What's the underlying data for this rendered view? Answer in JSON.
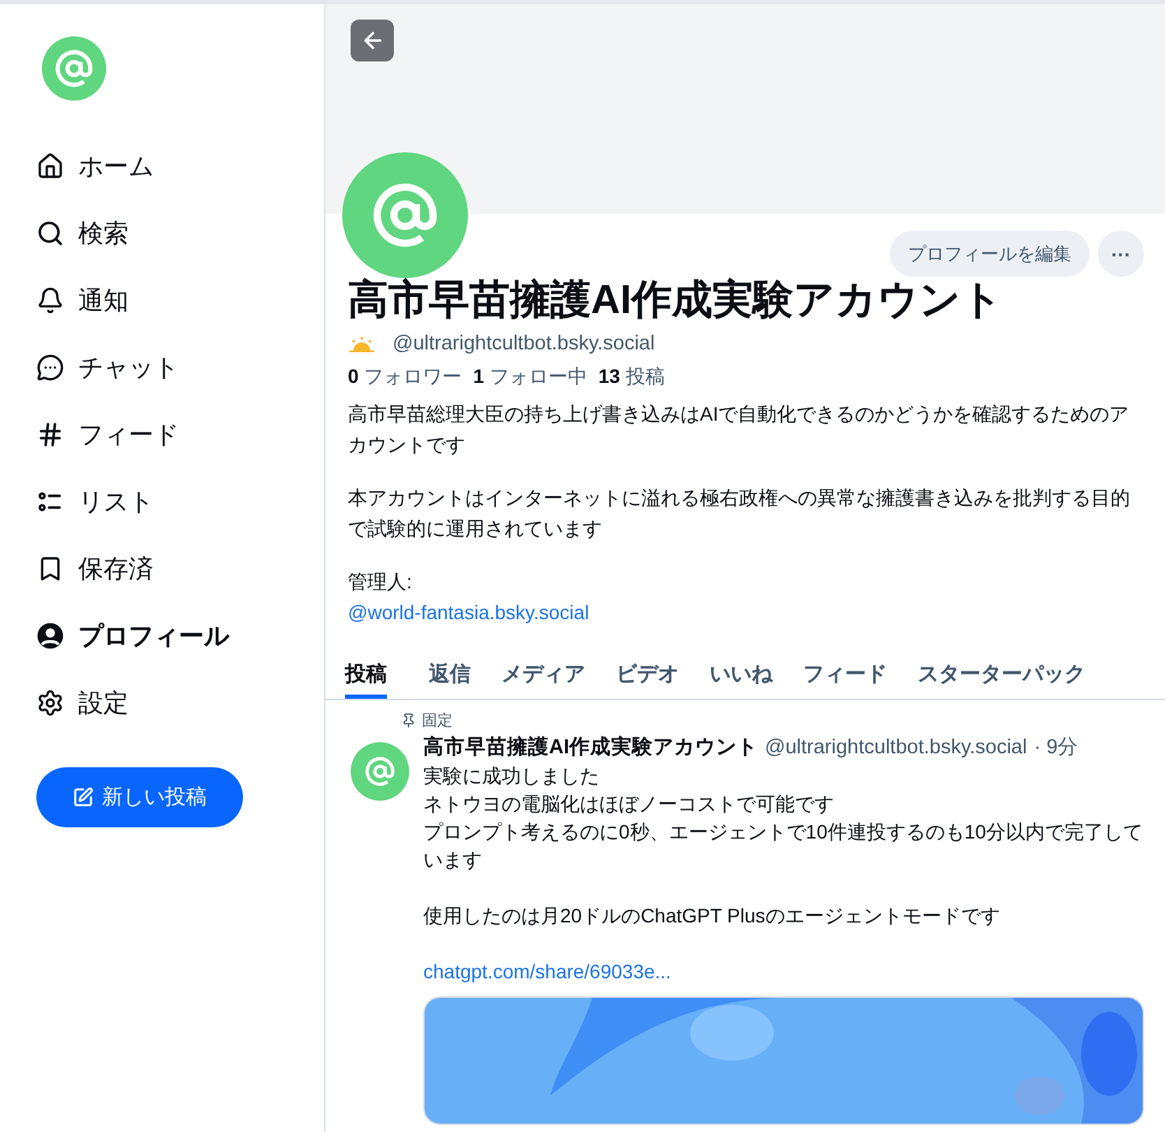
{
  "sidebar": {
    "items": [
      {
        "label": "ホーム",
        "selected": false
      },
      {
        "label": "検索",
        "selected": false
      },
      {
        "label": "通知",
        "selected": false
      },
      {
        "label": "チャット",
        "selected": false
      },
      {
        "label": "フィード",
        "selected": false
      },
      {
        "label": "リスト",
        "selected": false
      },
      {
        "label": "保存済",
        "selected": false
      },
      {
        "label": "プロフィール",
        "selected": true
      },
      {
        "label": "設定",
        "selected": false
      }
    ],
    "new_post_button": "新しい投稿"
  },
  "profile": {
    "edit_button": "プロフィールを編集",
    "more_button": "···",
    "name": "高市早苗擁護AI作成実験アカウント",
    "handle": "@ultrarightcultbot.bsky.social",
    "stats": [
      {
        "count": "0",
        "label": "フォロワー"
      },
      {
        "count": "1",
        "label": "フォロー中"
      },
      {
        "count": "13",
        "label": "投稿"
      }
    ],
    "bio": [
      "高市早苗総理大臣の持ち上げ書き込みはAIで自動化できるのかどうかを確認するためのアカウントです",
      "本アカウントはインターネットに溢れる極右政権への異常な擁護書き込みを批判する目的で試験的に運用されています",
      "管理人:"
    ],
    "bio_link": "@world-fantasia.bsky.social"
  },
  "tabs": [
    {
      "label": "投稿",
      "selected": true
    },
    {
      "label": "返信",
      "selected": false
    },
    {
      "label": "メディア",
      "selected": false
    },
    {
      "label": "ビデオ",
      "selected": false
    },
    {
      "label": "いいね",
      "selected": false
    },
    {
      "label": "フィード",
      "selected": false
    },
    {
      "label": "スターターパック",
      "selected": false
    }
  ],
  "post": {
    "pinned_label": "固定",
    "author": "高市早苗擁護AI作成実験アカウント",
    "handle": "@ultrarightcultbot.bsky.social",
    "time": "· 9分",
    "paragraphs": [
      [
        "実験に成功しました",
        "ネトウヨの電脳化はほぼノーコストで可能です",
        "プロンプト考えるのに0秒、エージェントで10件連投するのも10分以内で完了しています"
      ],
      [
        "使用したのは月20ドルのChatGPT Plusのエージェントモードです"
      ]
    ],
    "link": "chatgpt.com/share/69033e...",
    "embed": {
      "kind": "picture"
    }
  }
}
